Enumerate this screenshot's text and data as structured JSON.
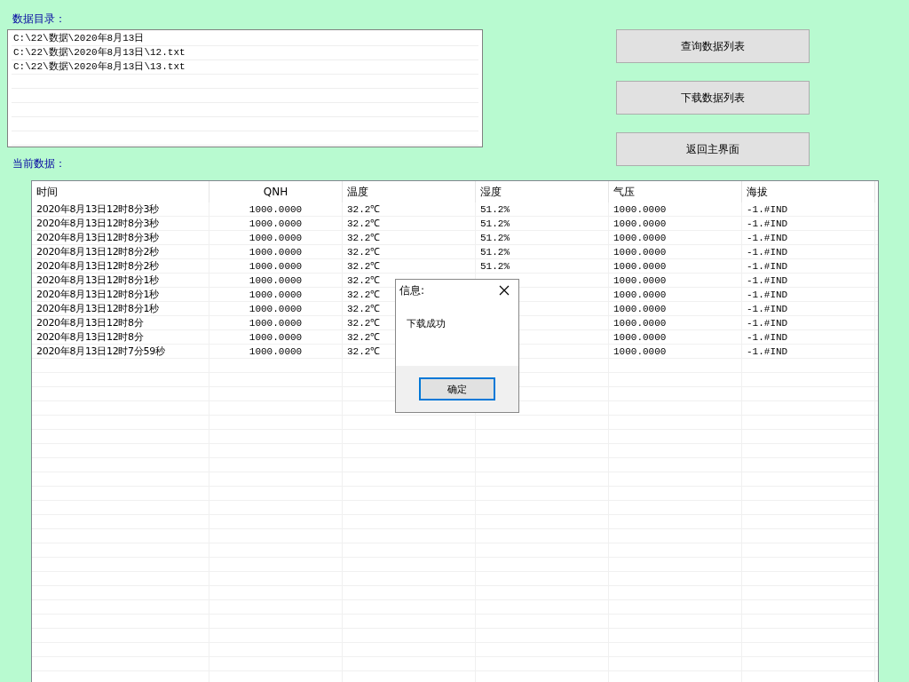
{
  "directory": {
    "label": "数据目录：",
    "items": [
      "C:\\22\\数据\\2020年8月13日",
      "C:\\22\\数据\\2020年8月13日\\12.txt",
      "C:\\22\\数据\\2020年8月13日\\13.txt"
    ]
  },
  "buttons": [
    "查询数据列表",
    "下载数据列表",
    "返回主界面"
  ],
  "current": {
    "label": "当前数据：",
    "columns": [
      "时间",
      "QNH",
      "温度",
      "湿度",
      "气压",
      "海拔"
    ],
    "rows": [
      [
        "2020年8月13日12时8分3秒",
        "1000.0000",
        "32.2℃",
        "51.2%",
        "1000.0000",
        "-1.#IND"
      ],
      [
        "2020年8月13日12时8分3秒",
        "1000.0000",
        "32.2℃",
        "51.2%",
        "1000.0000",
        "-1.#IND"
      ],
      [
        "2020年8月13日12时8分3秒",
        "1000.0000",
        "32.2℃",
        "51.2%",
        "1000.0000",
        "-1.#IND"
      ],
      [
        "2020年8月13日12时8分2秒",
        "1000.0000",
        "32.2℃",
        "51.2%",
        "1000.0000",
        "-1.#IND"
      ],
      [
        "2020年8月13日12时8分2秒",
        "1000.0000",
        "32.2℃",
        "51.2%",
        "1000.0000",
        "-1.#IND"
      ],
      [
        "2020年8月13日12时8分1秒",
        "1000.0000",
        "32.2℃",
        null,
        "1000.0000",
        "-1.#IND"
      ],
      [
        "2020年8月13日12时8分1秒",
        "1000.0000",
        "32.2℃",
        null,
        "1000.0000",
        "-1.#IND"
      ],
      [
        "2020年8月13日12时8分1秒",
        "1000.0000",
        "32.2℃",
        null,
        "1000.0000",
        "-1.#IND"
      ],
      [
        "2020年8月13日12时8分",
        "1000.0000",
        "32.2℃",
        null,
        "1000.0000",
        "-1.#IND"
      ],
      [
        "2020年8月13日12时8分",
        "1000.0000",
        "32.2℃",
        null,
        "1000.0000",
        "-1.#IND"
      ],
      [
        "2020年8月13日12时7分59秒",
        "1000.0000",
        "32.2℃",
        null,
        "1000.0000",
        "-1.#IND"
      ]
    ]
  },
  "dialog": {
    "title": "信息:",
    "message": "下载成功",
    "button": "确定"
  }
}
